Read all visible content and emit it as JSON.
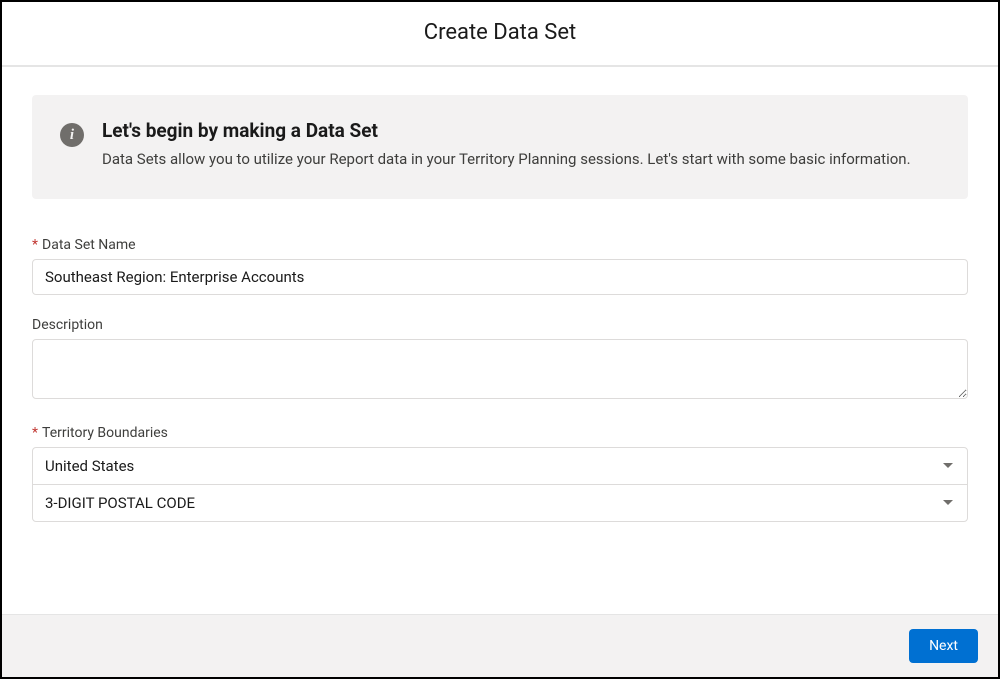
{
  "modal": {
    "title": "Create Data Set"
  },
  "info": {
    "heading": "Let's begin by making a Data Set",
    "text": "Data Sets allow you to utilize your Report data in your Territory Planning sessions. Let's start with some basic information."
  },
  "form": {
    "name": {
      "label": "Data Set Name",
      "value": "Southeast Region: Enterprise Accounts",
      "required_marker": "*"
    },
    "description": {
      "label": "Description",
      "value": ""
    },
    "territory": {
      "label": "Territory Boundaries",
      "required_marker": "*",
      "country_value": "United States",
      "granularity_value": "3-DIGIT POSTAL CODE"
    }
  },
  "footer": {
    "next_label": "Next"
  }
}
